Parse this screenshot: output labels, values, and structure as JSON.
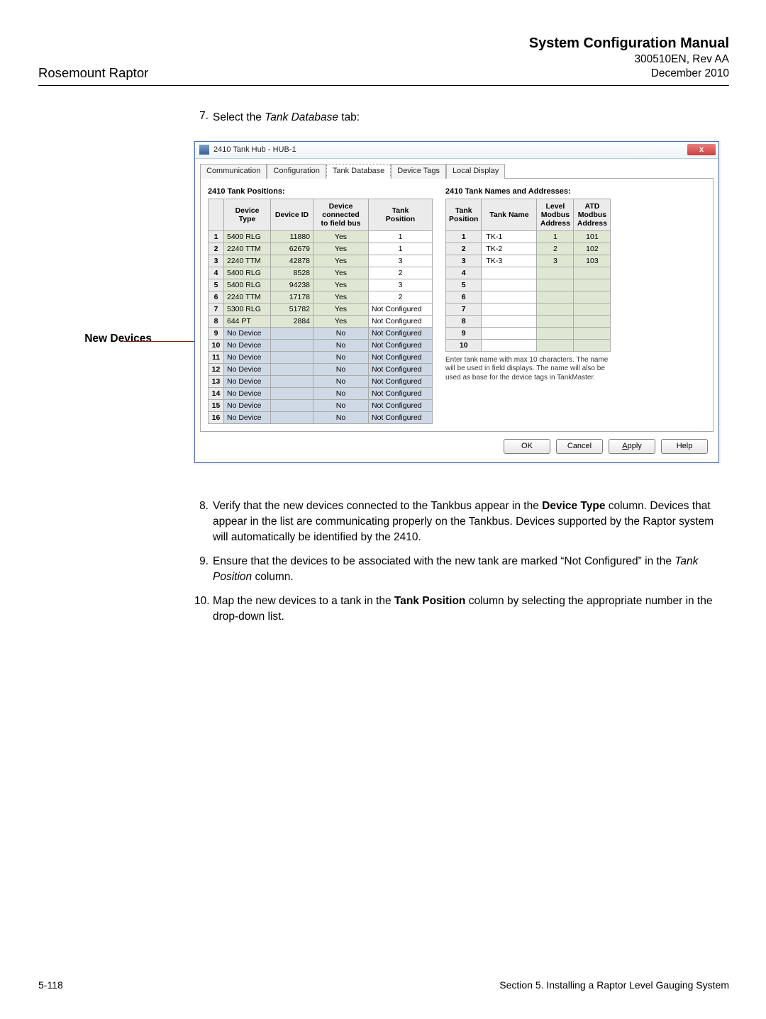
{
  "header": {
    "left": "Rosemount Raptor",
    "titleBold": "System Configuration Manual",
    "docNo": "300510EN, Rev AA",
    "date": "December 2010"
  },
  "step7": {
    "num": "7.",
    "before": "Select the ",
    "italic": "Tank Database",
    "after": " tab:"
  },
  "newDevicesLabel": "New Devices",
  "window": {
    "title": "2410 Tank Hub  - HUB-1",
    "closeGlyph": "x",
    "tabs": [
      "Communication",
      "Configuration",
      "Tank Database",
      "Device Tags",
      "Local Display"
    ],
    "leftTitle": "2410 Tank Positions:",
    "rightTitle": "2410 Tank Names and Addresses:",
    "leftCols": {
      "c1": "Device Type",
      "c2": "Device ID",
      "c3top": "Device",
      "c3mid": "connected",
      "c3bot": "to field bus",
      "c4top": "Tank",
      "c4bot": "Position"
    },
    "leftRows": [
      {
        "n": "1",
        "type": "5400 RLG",
        "id": "11880",
        "conn": "Yes",
        "pos": "1",
        "cls": "g"
      },
      {
        "n": "2",
        "type": "2240 TTM",
        "id": "62679",
        "conn": "Yes",
        "pos": "1",
        "cls": "g"
      },
      {
        "n": "3",
        "type": "2240 TTM",
        "id": "42878",
        "conn": "Yes",
        "pos": "3",
        "cls": "g"
      },
      {
        "n": "4",
        "type": "5400 RLG",
        "id": "8528",
        "conn": "Yes",
        "pos": "2",
        "cls": "g"
      },
      {
        "n": "5",
        "type": "5400 RLG",
        "id": "94238",
        "conn": "Yes",
        "pos": "3",
        "cls": "g"
      },
      {
        "n": "6",
        "type": "2240 TTM",
        "id": "17178",
        "conn": "Yes",
        "pos": "2",
        "cls": "g"
      },
      {
        "n": "7",
        "type": "5300 RLG",
        "id": "51782",
        "conn": "Yes",
        "pos": "Not Configured",
        "cls": "g"
      },
      {
        "n": "8",
        "type": "644 PT",
        "id": "2884",
        "conn": "Yes",
        "pos": "Not Configured",
        "cls": "g"
      },
      {
        "n": "9",
        "type": "No Device",
        "id": "",
        "conn": "No",
        "pos": "Not Configured",
        "cls": "b"
      },
      {
        "n": "10",
        "type": "No Device",
        "id": "",
        "conn": "No",
        "pos": "Not Configured",
        "cls": "b"
      },
      {
        "n": "11",
        "type": "No Device",
        "id": "",
        "conn": "No",
        "pos": "Not Configured",
        "cls": "b"
      },
      {
        "n": "12",
        "type": "No Device",
        "id": "",
        "conn": "No",
        "pos": "Not Configured",
        "cls": "b"
      },
      {
        "n": "13",
        "type": "No Device",
        "id": "",
        "conn": "No",
        "pos": "Not Configured",
        "cls": "b"
      },
      {
        "n": "14",
        "type": "No Device",
        "id": "",
        "conn": "No",
        "pos": "Not Configured",
        "cls": "b"
      },
      {
        "n": "15",
        "type": "No Device",
        "id": "",
        "conn": "No",
        "pos": "Not Configured",
        "cls": "b"
      },
      {
        "n": "16",
        "type": "No Device",
        "id": "",
        "conn": "No",
        "pos": "Not Configured",
        "cls": "b"
      }
    ],
    "rightCols": {
      "c1top": "Tank",
      "c1bot": "Position",
      "c2": "Tank Name",
      "c3top": "Level",
      "c3mid": "Modbus",
      "c3bot": "Address",
      "c4top": "ATD",
      "c4mid": "Modbus",
      "c4bot": "Address"
    },
    "rightRows": [
      {
        "n": "1",
        "name": "TK-1",
        "lm": "1",
        "am": "101"
      },
      {
        "n": "2",
        "name": "TK-2",
        "lm": "2",
        "am": "102"
      },
      {
        "n": "3",
        "name": "TK-3",
        "lm": "3",
        "am": "103"
      },
      {
        "n": "4",
        "name": "",
        "lm": "",
        "am": ""
      },
      {
        "n": "5",
        "name": "",
        "lm": "",
        "am": ""
      },
      {
        "n": "6",
        "name": "",
        "lm": "",
        "am": ""
      },
      {
        "n": "7",
        "name": "",
        "lm": "",
        "am": ""
      },
      {
        "n": "8",
        "name": "",
        "lm": "",
        "am": ""
      },
      {
        "n": "9",
        "name": "",
        "lm": "",
        "am": ""
      },
      {
        "n": "10",
        "name": "",
        "lm": "",
        "am": ""
      }
    ],
    "helpText": "Enter tank name with max 10 characters. The name will be used in field displays. The name will also be used as base for the device tags in TankMaster.",
    "buttons": {
      "ok": "OK",
      "cancel": "Cancel",
      "applyPre": "A",
      "applyRest": "pply",
      "help": "Help"
    }
  },
  "para8": {
    "num": "8.",
    "l1a": "Verify that the new devices connected to the Tankbus appear in the ",
    "l1b": "Device Type",
    "l1c": " column. Devices that appear in the list are communicating properly on the Tankbus. Devices supported by the Raptor system will automatically be identified by the 2410."
  },
  "para9": {
    "num": "9.",
    "l1": "Ensure that the devices to be associated with the new tank are marked “Not Configured” in the ",
    "l1i": "Tank Position",
    "l1e": " column."
  },
  "para10": {
    "num": "10.",
    "l1a": "Map the new devices to a tank in the ",
    "l1b": "Tank Position",
    "l1c": " column by selecting the appropriate number in the drop-down list."
  },
  "footer": {
    "left": "5-118",
    "right": "Section 5. Installing a Raptor Level Gauging System"
  }
}
